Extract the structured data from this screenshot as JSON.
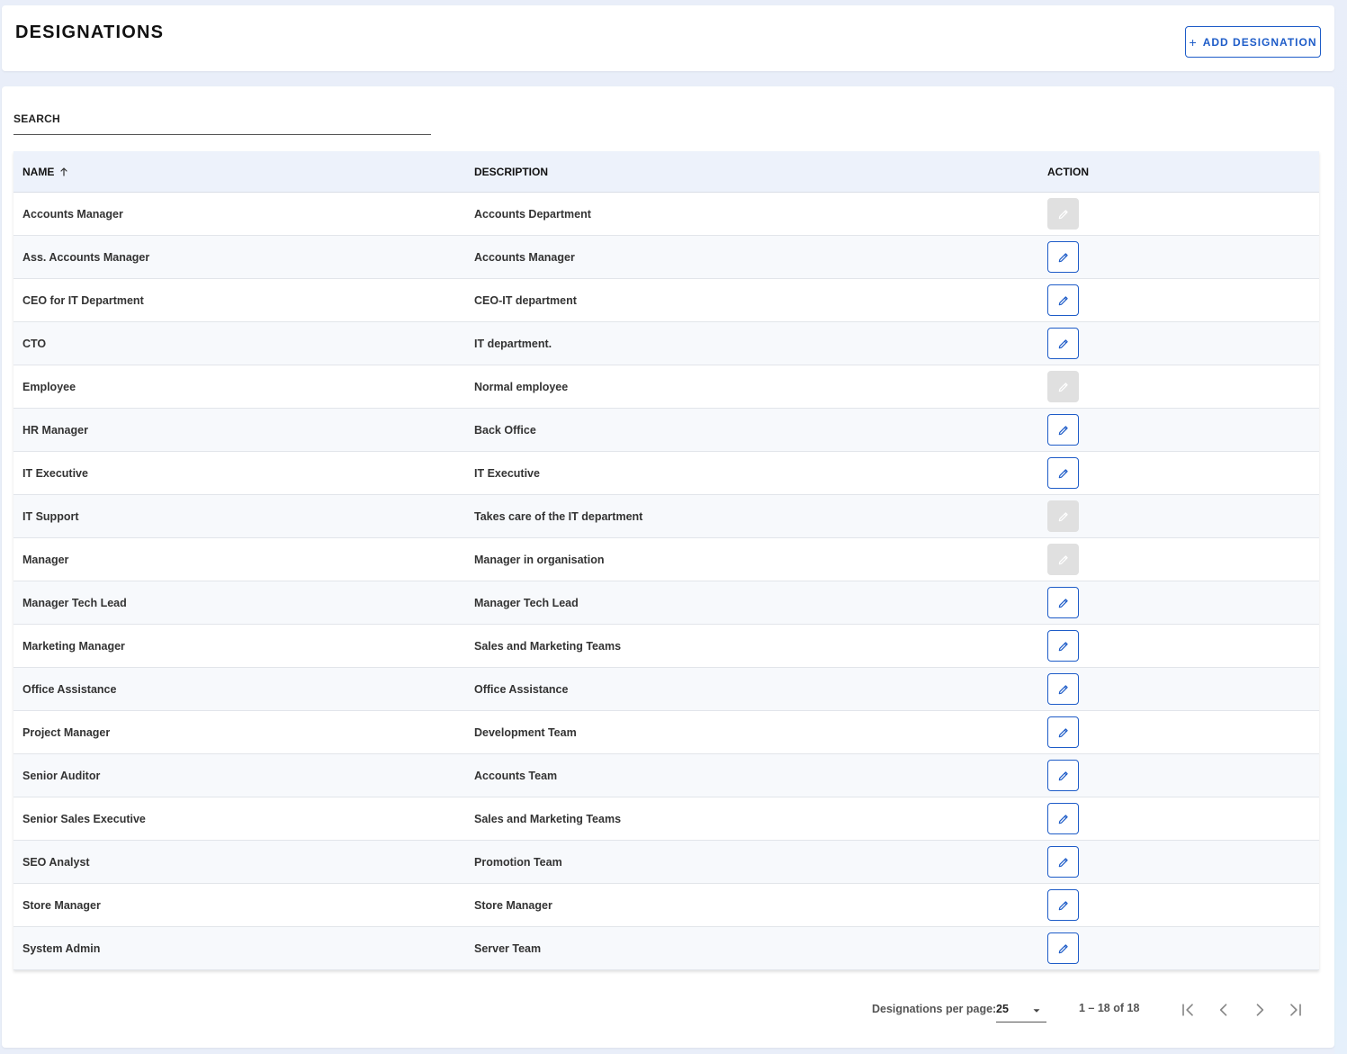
{
  "header": {
    "title": "DESIGNATIONS",
    "add_button_label": "ADD DESIGNATION"
  },
  "search": {
    "placeholder": "SEARCH",
    "value": ""
  },
  "table": {
    "columns": {
      "name": "NAME",
      "description": "DESCRIPTION",
      "action": "ACTION"
    },
    "sort": {
      "column": "name",
      "direction": "ascending",
      "icon": "arrow-up-icon"
    },
    "rows": [
      {
        "name": "Accounts Manager",
        "description": "Accounts Department",
        "editable": false
      },
      {
        "name": "Ass. Accounts Manager",
        "description": "Accounts Manager",
        "editable": true
      },
      {
        "name": "CEO for IT Department",
        "description": "CEO-IT department",
        "editable": true
      },
      {
        "name": "CTO",
        "description": "IT department.",
        "editable": true
      },
      {
        "name": "Employee",
        "description": "Normal employee",
        "editable": false
      },
      {
        "name": "HR Manager",
        "description": "Back Office",
        "editable": true
      },
      {
        "name": "IT Executive",
        "description": "IT Executive",
        "editable": true
      },
      {
        "name": "IT Support",
        "description": "Takes care of the IT department",
        "editable": false
      },
      {
        "name": "Manager",
        "description": "Manager in organisation",
        "editable": false
      },
      {
        "name": "Manager Tech Lead",
        "description": "Manager Tech Lead",
        "editable": true
      },
      {
        "name": "Marketing Manager",
        "description": "Sales and Marketing Teams",
        "editable": true
      },
      {
        "name": "Office Assistance",
        "description": "Office Assistance",
        "editable": true
      },
      {
        "name": "Project Manager",
        "description": "Development Team",
        "editable": true
      },
      {
        "name": "Senior Auditor",
        "description": "Accounts Team",
        "editable": true
      },
      {
        "name": "Senior Sales Executive",
        "description": "Sales and Marketing Teams",
        "editable": true
      },
      {
        "name": "SEO Analyst",
        "description": "Promotion Team",
        "editable": true
      },
      {
        "name": "Store Manager",
        "description": "Store Manager",
        "editable": true
      },
      {
        "name": "System Admin",
        "description": "Server Team",
        "editable": true
      }
    ]
  },
  "pagination": {
    "per_page_label": "Designations per page:",
    "per_page_value": "25",
    "range_label": "1 – 18 of 18",
    "buttons": [
      "first-page-icon",
      "prev-page-icon",
      "next-page-icon",
      "last-page-icon"
    ]
  },
  "colors": {
    "accent": "#1e5cc8",
    "header_bg": "#edf2fb",
    "page_bg": "#e9eef9",
    "disabled_bg": "#e0e0e0"
  }
}
